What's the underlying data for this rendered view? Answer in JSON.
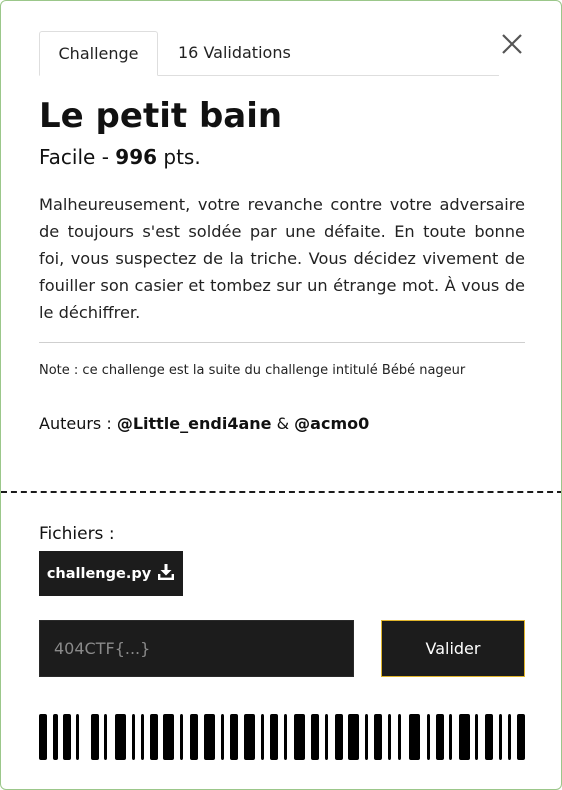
{
  "tabs": {
    "challenge": "Challenge",
    "validations": "16 Validations"
  },
  "challenge": {
    "title": "Le petit bain",
    "difficulty": "Facile",
    "separator": " - ",
    "points": "996",
    "points_unit": " pts.",
    "description": "Malheureusement, votre revanche contre votre adversaire de toujours s'est soldée par une défaite. En toute bonne foi, vous suspectez de la triche. Vous décidez vivement de fouiller son casier et tombez sur un étrange mot. À vous de le déchiffrer.",
    "note": "Note : ce challenge est la suite du challenge intitulé Bébé nageur",
    "authors_label": "Auteurs : ",
    "author1": "@Little_endi4ane",
    "authors_and": " & ",
    "author2": "@acmo0"
  },
  "files": {
    "label": "Fichiers :",
    "items": [
      {
        "name": "challenge.py",
        "icon": "download-icon"
      }
    ]
  },
  "flag": {
    "placeholder": "404CTF{...}",
    "value": "",
    "submit_label": "Valider"
  },
  "colors": {
    "card_border": "#9bc78a",
    "dark": "#1c1c1c",
    "accent": "#e0b52c"
  }
}
